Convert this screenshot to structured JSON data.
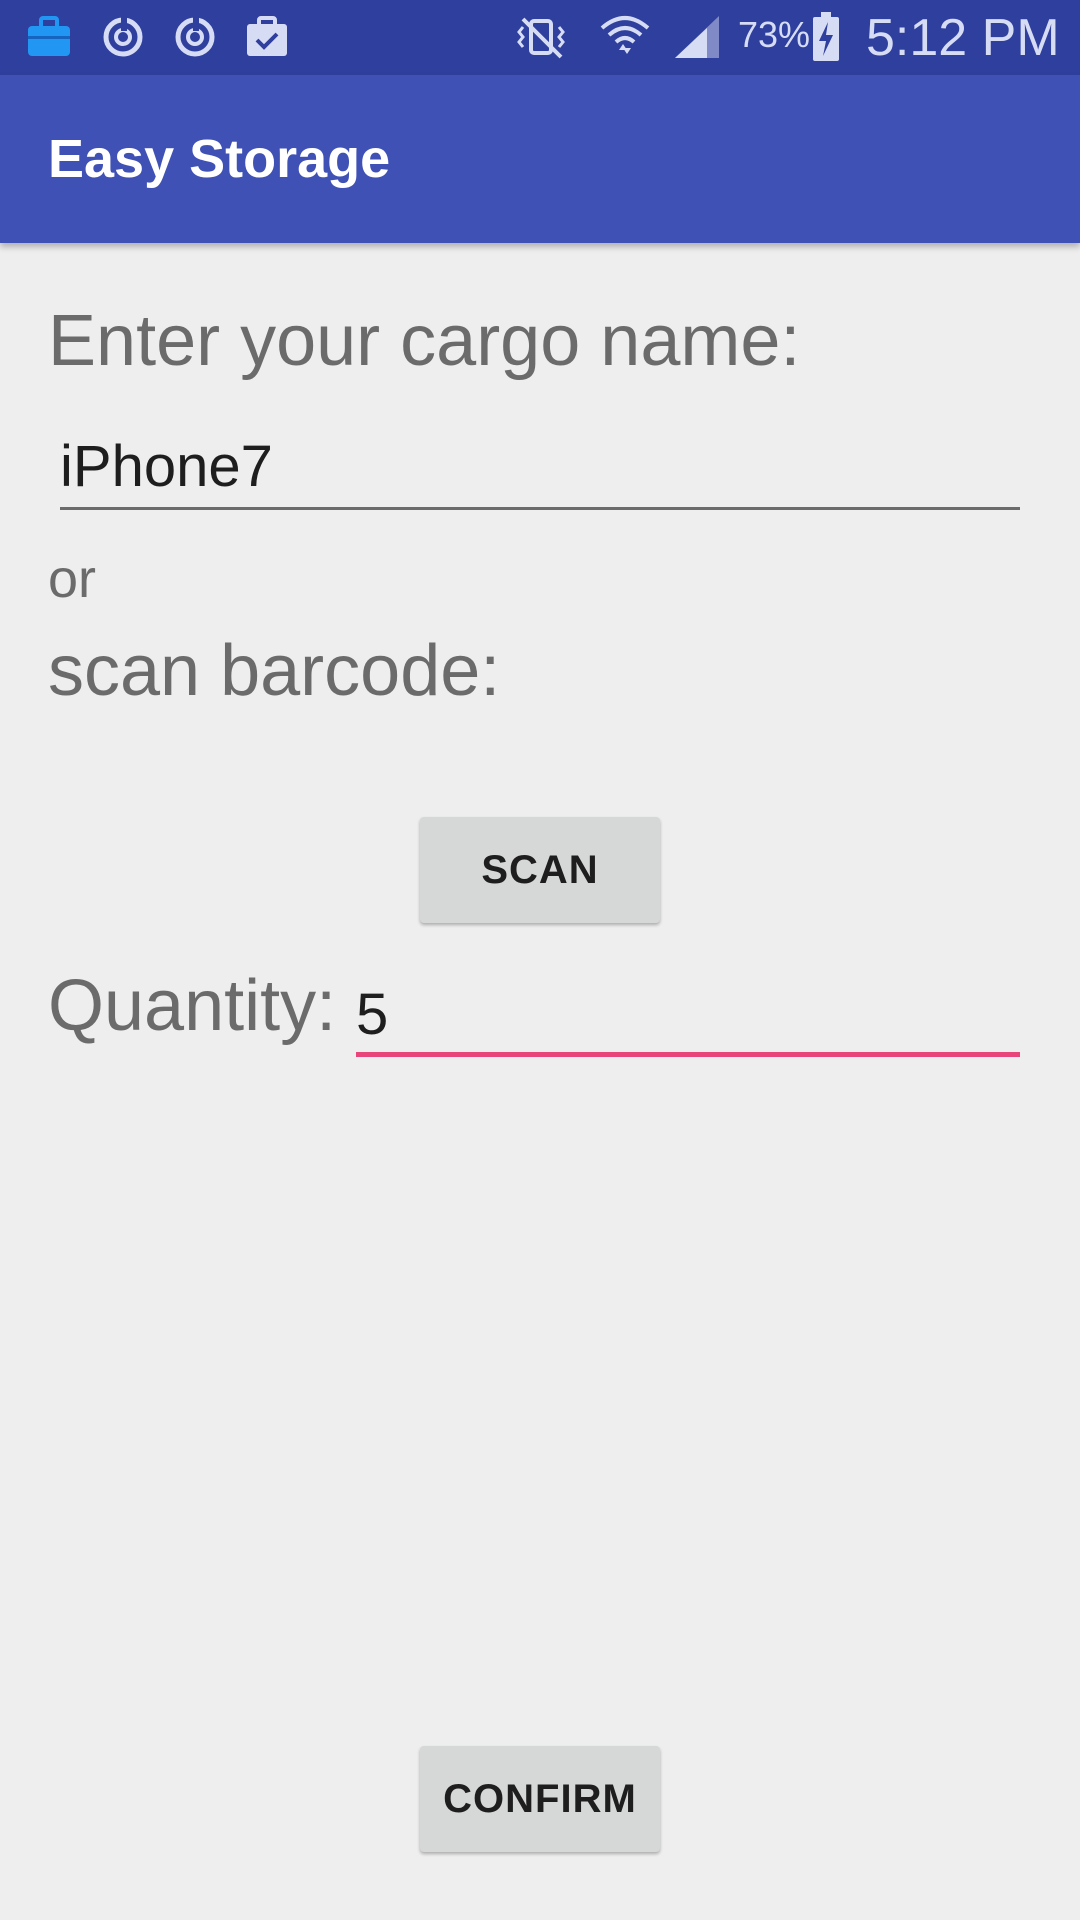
{
  "status_bar": {
    "left_icons": [
      "briefcase-icon",
      "sync-icon",
      "sync-icon",
      "clipboard-check-icon"
    ],
    "right_icons": [
      "vibrate-off-icon",
      "wifi-icon",
      "cell-signal-icon",
      "battery-charging-icon"
    ],
    "battery_percent": "73%",
    "time": "5:12 PM",
    "background_color": "#2f3f9e"
  },
  "app_bar": {
    "title": "Easy Storage",
    "background_color": "#3f51b5"
  },
  "form": {
    "cargo_label": "Enter your cargo name:",
    "cargo_value": "iPhone7",
    "or_label": "or",
    "scan_label": "scan barcode:",
    "scan_button": "SCAN",
    "quantity_label": "Quantity:",
    "quantity_value": "5",
    "accent_color": "#e8467a"
  },
  "footer": {
    "confirm_button": "CONFIRM"
  }
}
